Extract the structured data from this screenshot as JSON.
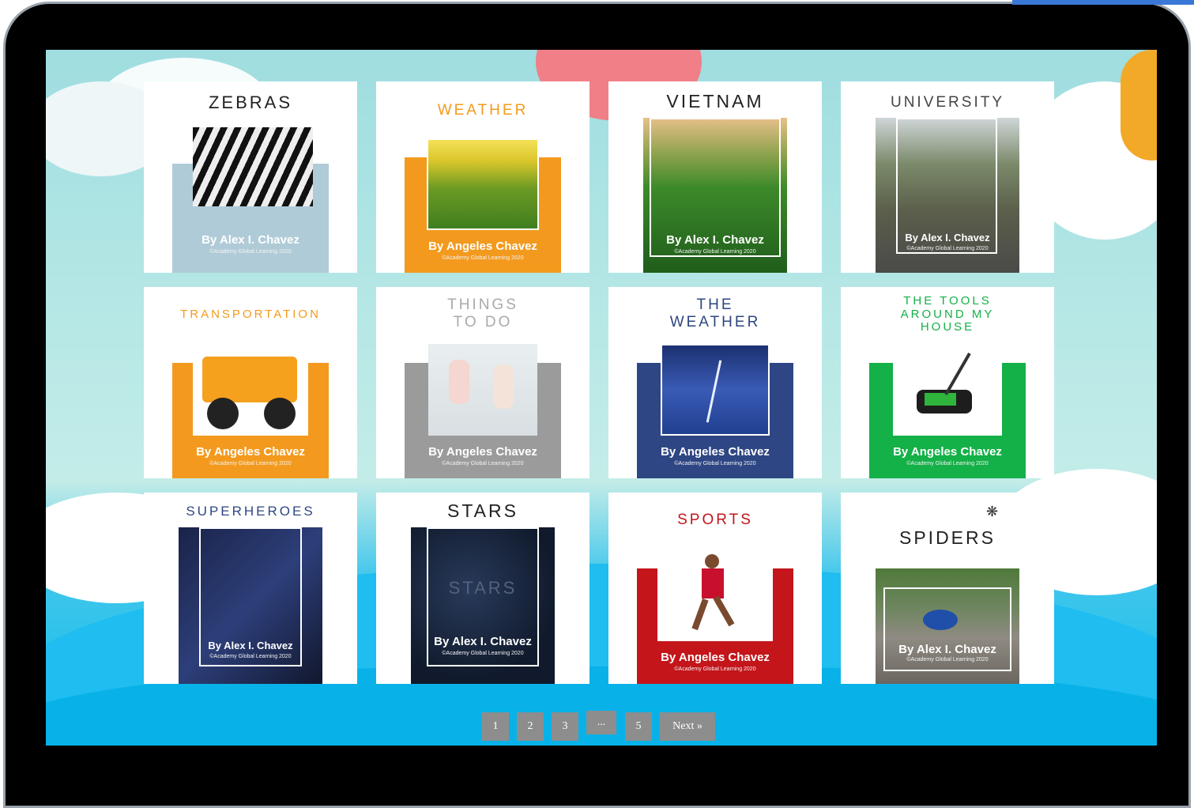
{
  "colors": {
    "orange": "#f39a1e",
    "blue_gray": "#b0cbd8",
    "gray": "#9b9b9b",
    "navy": "#2e4683",
    "green": "#14b048",
    "red": "#c3151a",
    "dark_navy": "#162033"
  },
  "icons": {
    "spider": "spider-icon"
  },
  "books": [
    {
      "title": "ZEBRAS",
      "author": "By Alex I. Chavez",
      "copyright": "©Academy Global Learning 2020",
      "image": "zebra photo"
    },
    {
      "title": "WEATHER",
      "author": "By Angeles Chavez",
      "copyright": "©Academy Global Learning 2020",
      "image": "daisy field photo"
    },
    {
      "title": "VIETNAM",
      "author": "By Alex I. Chavez",
      "copyright": "©Academy Global Learning 2020",
      "image": "rice terraces photo"
    },
    {
      "title": "UNIVERSITY",
      "author": "By Alex I. Chavez",
      "copyright": "©Academy Global Learning 2020",
      "image": "campus photo"
    },
    {
      "title": "TRANSPORTATION",
      "author": "By Angeles Chavez",
      "copyright": "©Academy Global Learning 2020",
      "image": "jeep photo"
    },
    {
      "title": "THINGS\nTO DO",
      "author": "By Angeles Chavez",
      "copyright": "©Academy Global Learning 2020",
      "image": "jumping girls photo"
    },
    {
      "title": "THE\nWEATHER",
      "author": "By Angeles Chavez",
      "copyright": "©Academy Global Learning 2020",
      "image": "lightning photo"
    },
    {
      "title": "THE TOOLS\nAROUND MY\nHOUSE",
      "author": "By Angeles Chavez",
      "copyright": "©Academy Global Learning 2020",
      "image": "lawn mower photo"
    },
    {
      "title": "SUPERHEROES",
      "author": "By Alex I. Chavez",
      "copyright": "©Academy Global Learning 2020",
      "image": "superhero photo"
    },
    {
      "title": "STARS",
      "author": "By Alex I. Chavez",
      "copyright": "©Academy Global Learning 2020",
      "image": "starry sky photo",
      "overlay_text": "STARS"
    },
    {
      "title": "SPORTS",
      "author": "By Angeles Chavez",
      "copyright": "©Academy Global Learning 2020",
      "image": "basketball player photo"
    },
    {
      "title": "SPIDERS",
      "author": "By Alex I. Chavez",
      "copyright": "©Academy Global Learning 2020",
      "image": "spider photo"
    }
  ],
  "pagination": {
    "pages": [
      "1",
      "2",
      "3",
      "...",
      "5"
    ],
    "next": "Next »"
  }
}
